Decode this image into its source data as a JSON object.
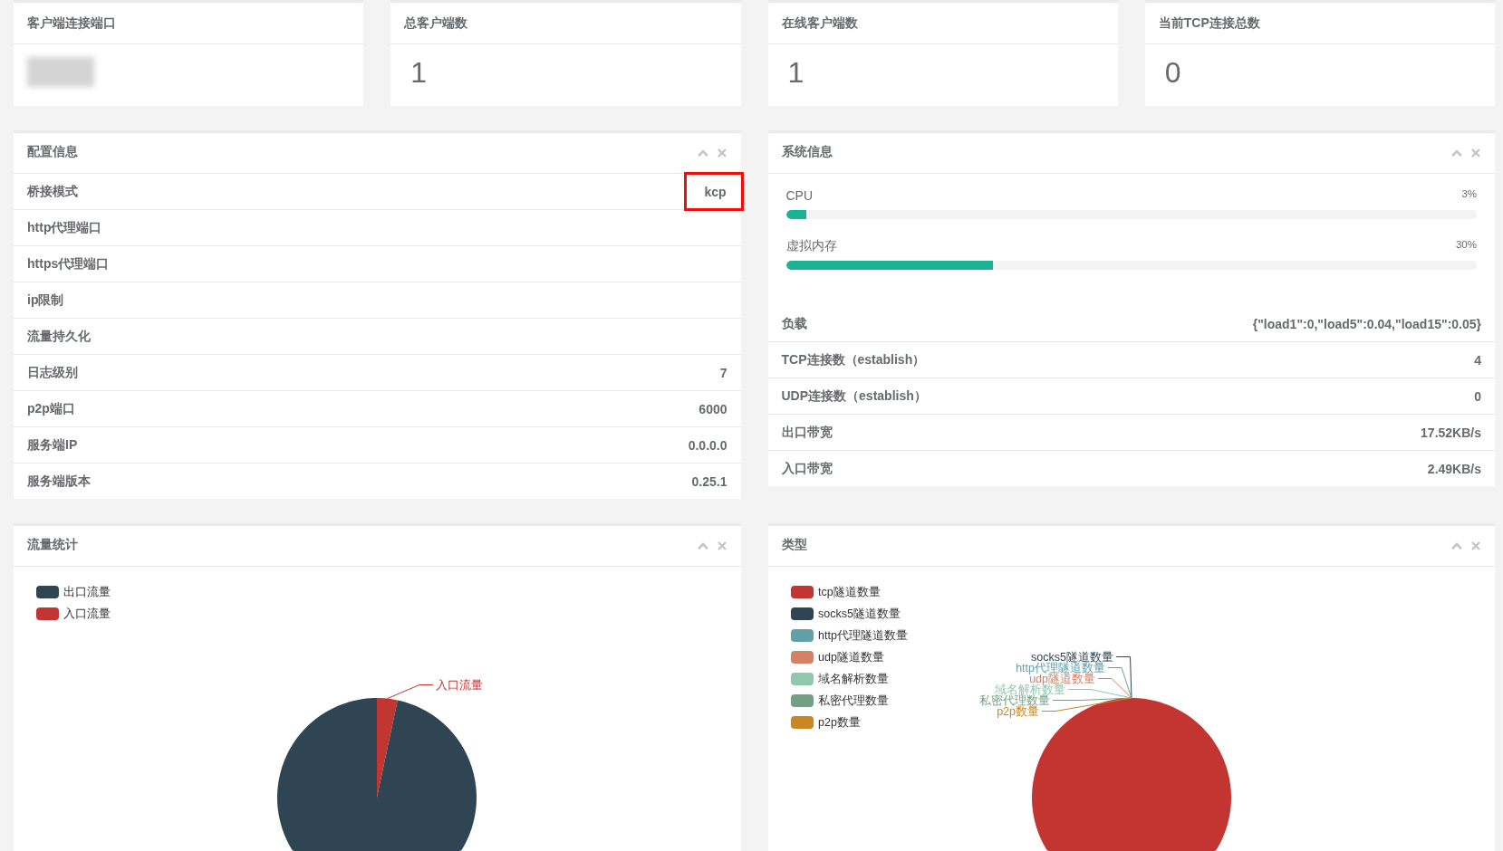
{
  "stats": [
    {
      "title": "客户端连接端口",
      "redacted": true
    },
    {
      "title": "总客户端数",
      "value": "1",
      "redacted": false
    },
    {
      "title": "在线客户端数",
      "value": "1",
      "redacted": false
    },
    {
      "title": "当前TCP连接总数",
      "value": "0",
      "redacted": false
    }
  ],
  "config_panel": {
    "title": "配置信息",
    "rows": [
      {
        "label": "桥接模式",
        "value": "kcp",
        "highlighted": true
      },
      {
        "label": "http代理端口",
        "highlighted": false
      },
      {
        "label": "https代理端口",
        "highlighted": false
      },
      {
        "label": "ip限制",
        "highlighted": false
      },
      {
        "label": "流量持久化",
        "highlighted": false
      },
      {
        "label": "日志级别",
        "value": "7",
        "highlighted": false
      },
      {
        "label": "p2p端口",
        "value": "6000",
        "highlighted": false
      },
      {
        "label": "服务端IP",
        "value": "0.0.0.0",
        "highlighted": false
      },
      {
        "label": "服务端版本",
        "value": "0.25.1",
        "highlighted": false
      }
    ]
  },
  "system_panel": {
    "title": "系统信息",
    "meters": [
      {
        "label": "CPU",
        "level": 0.03,
        "reading": "3%"
      },
      {
        "label": "虚拟内存",
        "level": 0.3,
        "reading": "30%"
      }
    ],
    "rows": [
      {
        "label": "负载",
        "value": "{\"load1\":0,\"load5\":0.04,\"load15\":0.05}"
      },
      {
        "label": "TCP连接数（establish）",
        "value": "4"
      },
      {
        "label": "UDP连接数（establish）",
        "value": "0"
      },
      {
        "label": "出口带宽",
        "value": "17.52KB/s"
      },
      {
        "label": "入口带宽",
        "value": "2.49KB/s"
      }
    ]
  },
  "traffic_panel": {
    "title": "流量统计",
    "legend": [
      {
        "label": "出口流量",
        "color": "#2f4554"
      },
      {
        "label": "入口流量",
        "color": "#c23531"
      }
    ],
    "slice_labels": [
      {
        "text": "入口流量",
        "color": "#c23531"
      }
    ]
  },
  "type_panel": {
    "title": "类型",
    "legend": [
      {
        "label": "tcp隧道数量",
        "color": "#c23531"
      },
      {
        "label": "socks5隧道数量",
        "color": "#2f4554"
      },
      {
        "label": "http代理隧道数量",
        "color": "#61a0a8"
      },
      {
        "label": "udp隧道数量",
        "color": "#d48265"
      },
      {
        "label": "域名解析数量",
        "color": "#91c7ae"
      },
      {
        "label": "私密代理数量",
        "color": "#749f83"
      },
      {
        "label": "p2p数量",
        "color": "#ca8622"
      }
    ],
    "slice_labels": [
      {
        "text": "socks5隧道数量",
        "color": "#2f4554"
      },
      {
        "text": "http代理隧道数量",
        "color": "#61a0a8"
      },
      {
        "text": "udp隧道数量",
        "color": "#d48265"
      },
      {
        "text": "域名解析数量",
        "color": "#91c7ae"
      },
      {
        "text": "私密代理数量",
        "color": "#749f83"
      },
      {
        "text": "p2p数量",
        "color": "#ca8622"
      }
    ]
  }
}
